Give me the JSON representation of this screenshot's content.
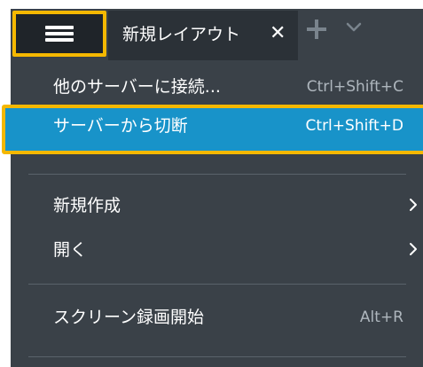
{
  "tabbar": {
    "tab_label": "新規レイアウト",
    "close_glyph": "✕",
    "menu_icon": "hamburger-icon",
    "add_icon": "plus-icon",
    "more_icon": "chevron-down-icon"
  },
  "menu": {
    "items": [
      {
        "label": "他のサーバーに接続...",
        "shortcut": "Ctrl+Shift+C"
      },
      {
        "label": "サーバーから切断",
        "shortcut": "Ctrl+Shift+D"
      },
      {
        "label": "新規作成",
        "shortcut": ""
      },
      {
        "label": "開く",
        "shortcut": ""
      },
      {
        "label": "スクリーン録画開始",
        "shortcut": "Alt+R"
      }
    ]
  },
  "colors": {
    "menu_background": "#3a4148",
    "highlight": "#1893c9",
    "annotation_outline": "#f5b800",
    "tab_background": "#2b3137"
  }
}
